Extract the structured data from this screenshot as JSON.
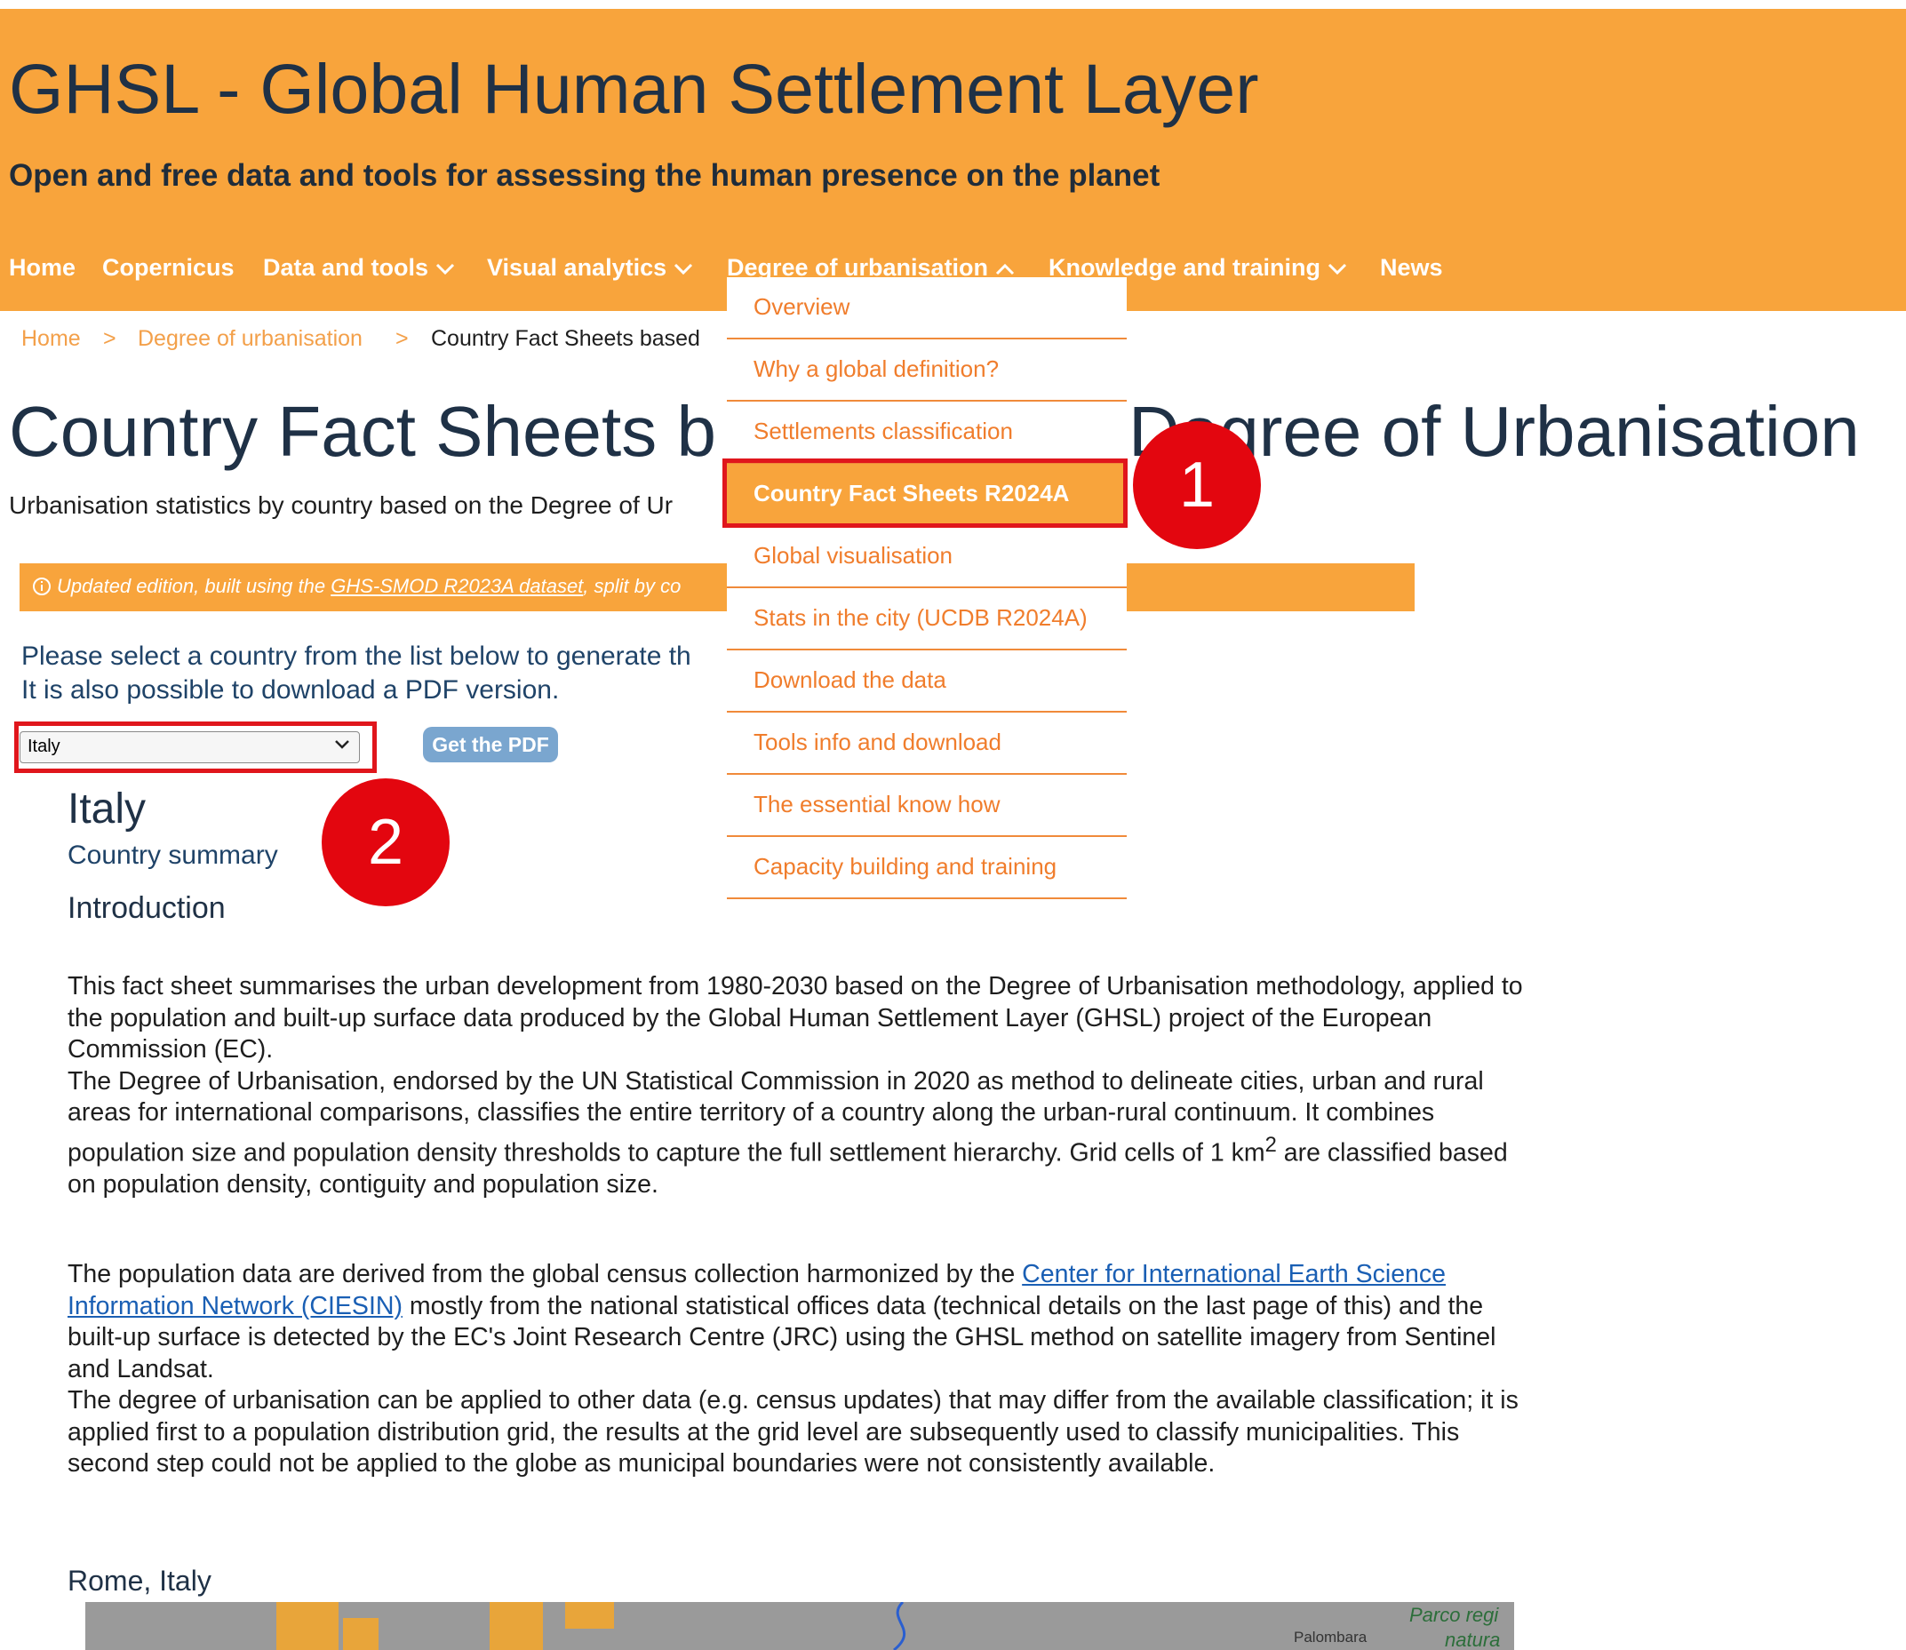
{
  "header": {
    "title": "GHSL - Global Human Settlement Layer",
    "tagline": "Open and free data and tools for assessing the human presence on the planet"
  },
  "nav": {
    "items": [
      {
        "label": "Home"
      },
      {
        "label": "Copernicus"
      },
      {
        "label": "Data and tools"
      },
      {
        "label": "Visual analytics"
      },
      {
        "label": "Degree of urbanisation"
      },
      {
        "label": "Knowledge and training"
      },
      {
        "label": "News"
      }
    ]
  },
  "dropdown": {
    "items": [
      {
        "label": "Overview"
      },
      {
        "label": "Why a global definition?"
      },
      {
        "label": "Settlements classification"
      },
      {
        "label": "Country Fact Sheets R2024A"
      },
      {
        "label": "Global visualisation"
      },
      {
        "label": "Stats in the city (UCDB R2024A)"
      },
      {
        "label": "Download the data"
      },
      {
        "label": "Tools info and download"
      },
      {
        "label": "The essential know how"
      },
      {
        "label": "Capacity building and training"
      }
    ],
    "active_index": 3
  },
  "breadcrumb": {
    "items": [
      "Home",
      "Degree of urbanisation",
      "Country Fact Sheets based"
    ],
    "separator": ">"
  },
  "page": {
    "title_left": "Country Fact Sheets b",
    "title_right": "Degree of Urbanisation",
    "subtitle": "Urbanisation statistics by country based on the Degree of Ur",
    "notice": {
      "icon": "info-icon",
      "prefix": "Updated edition, built using the ",
      "link": "GHS-SMOD R2023A dataset",
      "suffix": ", split by co"
    },
    "instruction_line1": "Please select a country from the list below to generate th",
    "instruction_line2": "It is also possible to download a PDF version.",
    "country_select_value": "Italy",
    "pdf_button_label": "Get the PDF"
  },
  "content": {
    "country_name": "Italy",
    "country_summary": "Country summary",
    "intro_heading": "Introduction",
    "para1_line1": "This fact sheet summarises the urban development from 1980-2030 based on the Degree of Urbanisation methodology, applied to the population and built-up surface data produced by the Global Human Settlement Layer (GHSL) project of the European Commission (EC).",
    "para1_line2": "The Degree of Urbanisation, endorsed by the UN Statistical Commission in 2020 as method to delineate cities, urban and rural areas for international comparisons, classifies the entire territory of a country along the urban-rural continuum. It combines population size and population density thresholds to capture the full settlement hierarchy. Grid cells of 1 km",
    "para1_sup": "2",
    "para1_end": " are classified based on population density, contiguity and population size.",
    "para2_before_link": "The population data are derived from the global census collection harmonized by the ",
    "para2_link": "Center for International Earth Science Information Network (CIESIN)",
    "para2_after_link": " mostly from the national statistical offices data (technical details on the last page of this) and the built-up surface is detected by the EC's Joint Research Centre (JRC) using the GHSL method on satellite imagery from Sentinel and Landsat.",
    "para3": "The degree of urbanisation can be applied to other data (e.g. census updates) that may differ from the available classification; it is applied first to a population distribution grid, the results at the grid level are subsequently used to classify municipalities. This second step could not be applied to the globe as municipal boundaries were not consistently available.",
    "map_caption": "Rome, Italy",
    "map_labels": [
      "Palombara",
      "Parco regi",
      "natura"
    ]
  },
  "annotations": {
    "badge1": "1",
    "badge2": "2",
    "highlight_color": "#e0161c"
  },
  "colors": {
    "header_bg": "#f8a43c",
    "title_text": "#1f3146",
    "dropdown_link": "#f07d2c",
    "link_blue": "#1a5fb4"
  }
}
